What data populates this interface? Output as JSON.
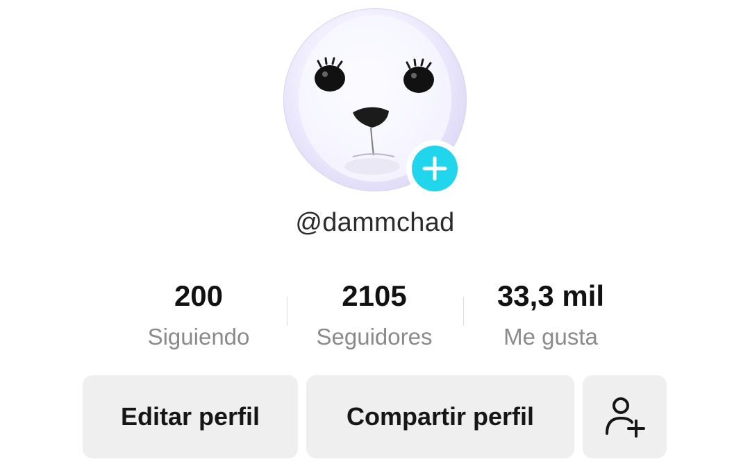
{
  "profile": {
    "username": "@dammchad",
    "avatar_icon": "seal-avatar",
    "add_badge_icon": "plus-icon",
    "badge_color": "#20d5ec"
  },
  "stats": {
    "following": {
      "value": "200",
      "label": "Siguiendo"
    },
    "followers": {
      "value": "2105",
      "label": "Seguidores"
    },
    "likes": {
      "value": "33,3 mil",
      "label": "Me gusta"
    }
  },
  "actions": {
    "edit_label": "Editar perfil",
    "share_label": "Compartir perfil",
    "add_friend_icon": "add-user-icon"
  }
}
